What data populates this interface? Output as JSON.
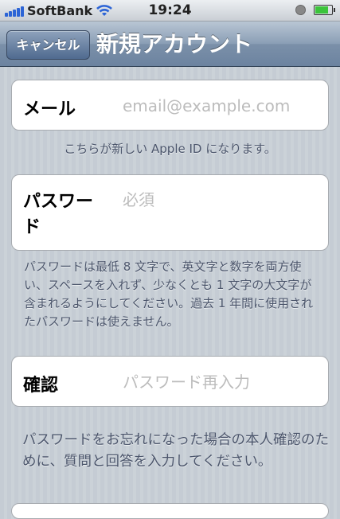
{
  "status_bar": {
    "carrier": "SoftBank",
    "time": "19:24",
    "signal_icon": "signal-bars-icon",
    "wifi_icon": "wifi-icon",
    "battery_level": 0.85,
    "battery_color": "#3bc43b"
  },
  "nav_bar": {
    "cancel_label": "キャンセル",
    "title": "新規アカウント"
  },
  "form": {
    "email": {
      "label": "メール",
      "placeholder": "email@example.com",
      "value": ""
    },
    "email_note": "こちらが新しい Apple ID になります。",
    "password": {
      "label": "パスワード",
      "placeholder": "必須",
      "value": ""
    },
    "password_note": "パスワードは最低 8 文字で、英文字と数字を両方使い、スペースを入れず、少なくとも 1 文字の大文字が含まれるようにしてください。過去 1 年間に使用されたパスワードは使えません。",
    "confirm": {
      "label": "確認",
      "placeholder": "パスワード再入力",
      "value": ""
    },
    "security_note": "パスワードをお忘れになった場合の本人確認のために、質問と回答を入力してください。"
  }
}
